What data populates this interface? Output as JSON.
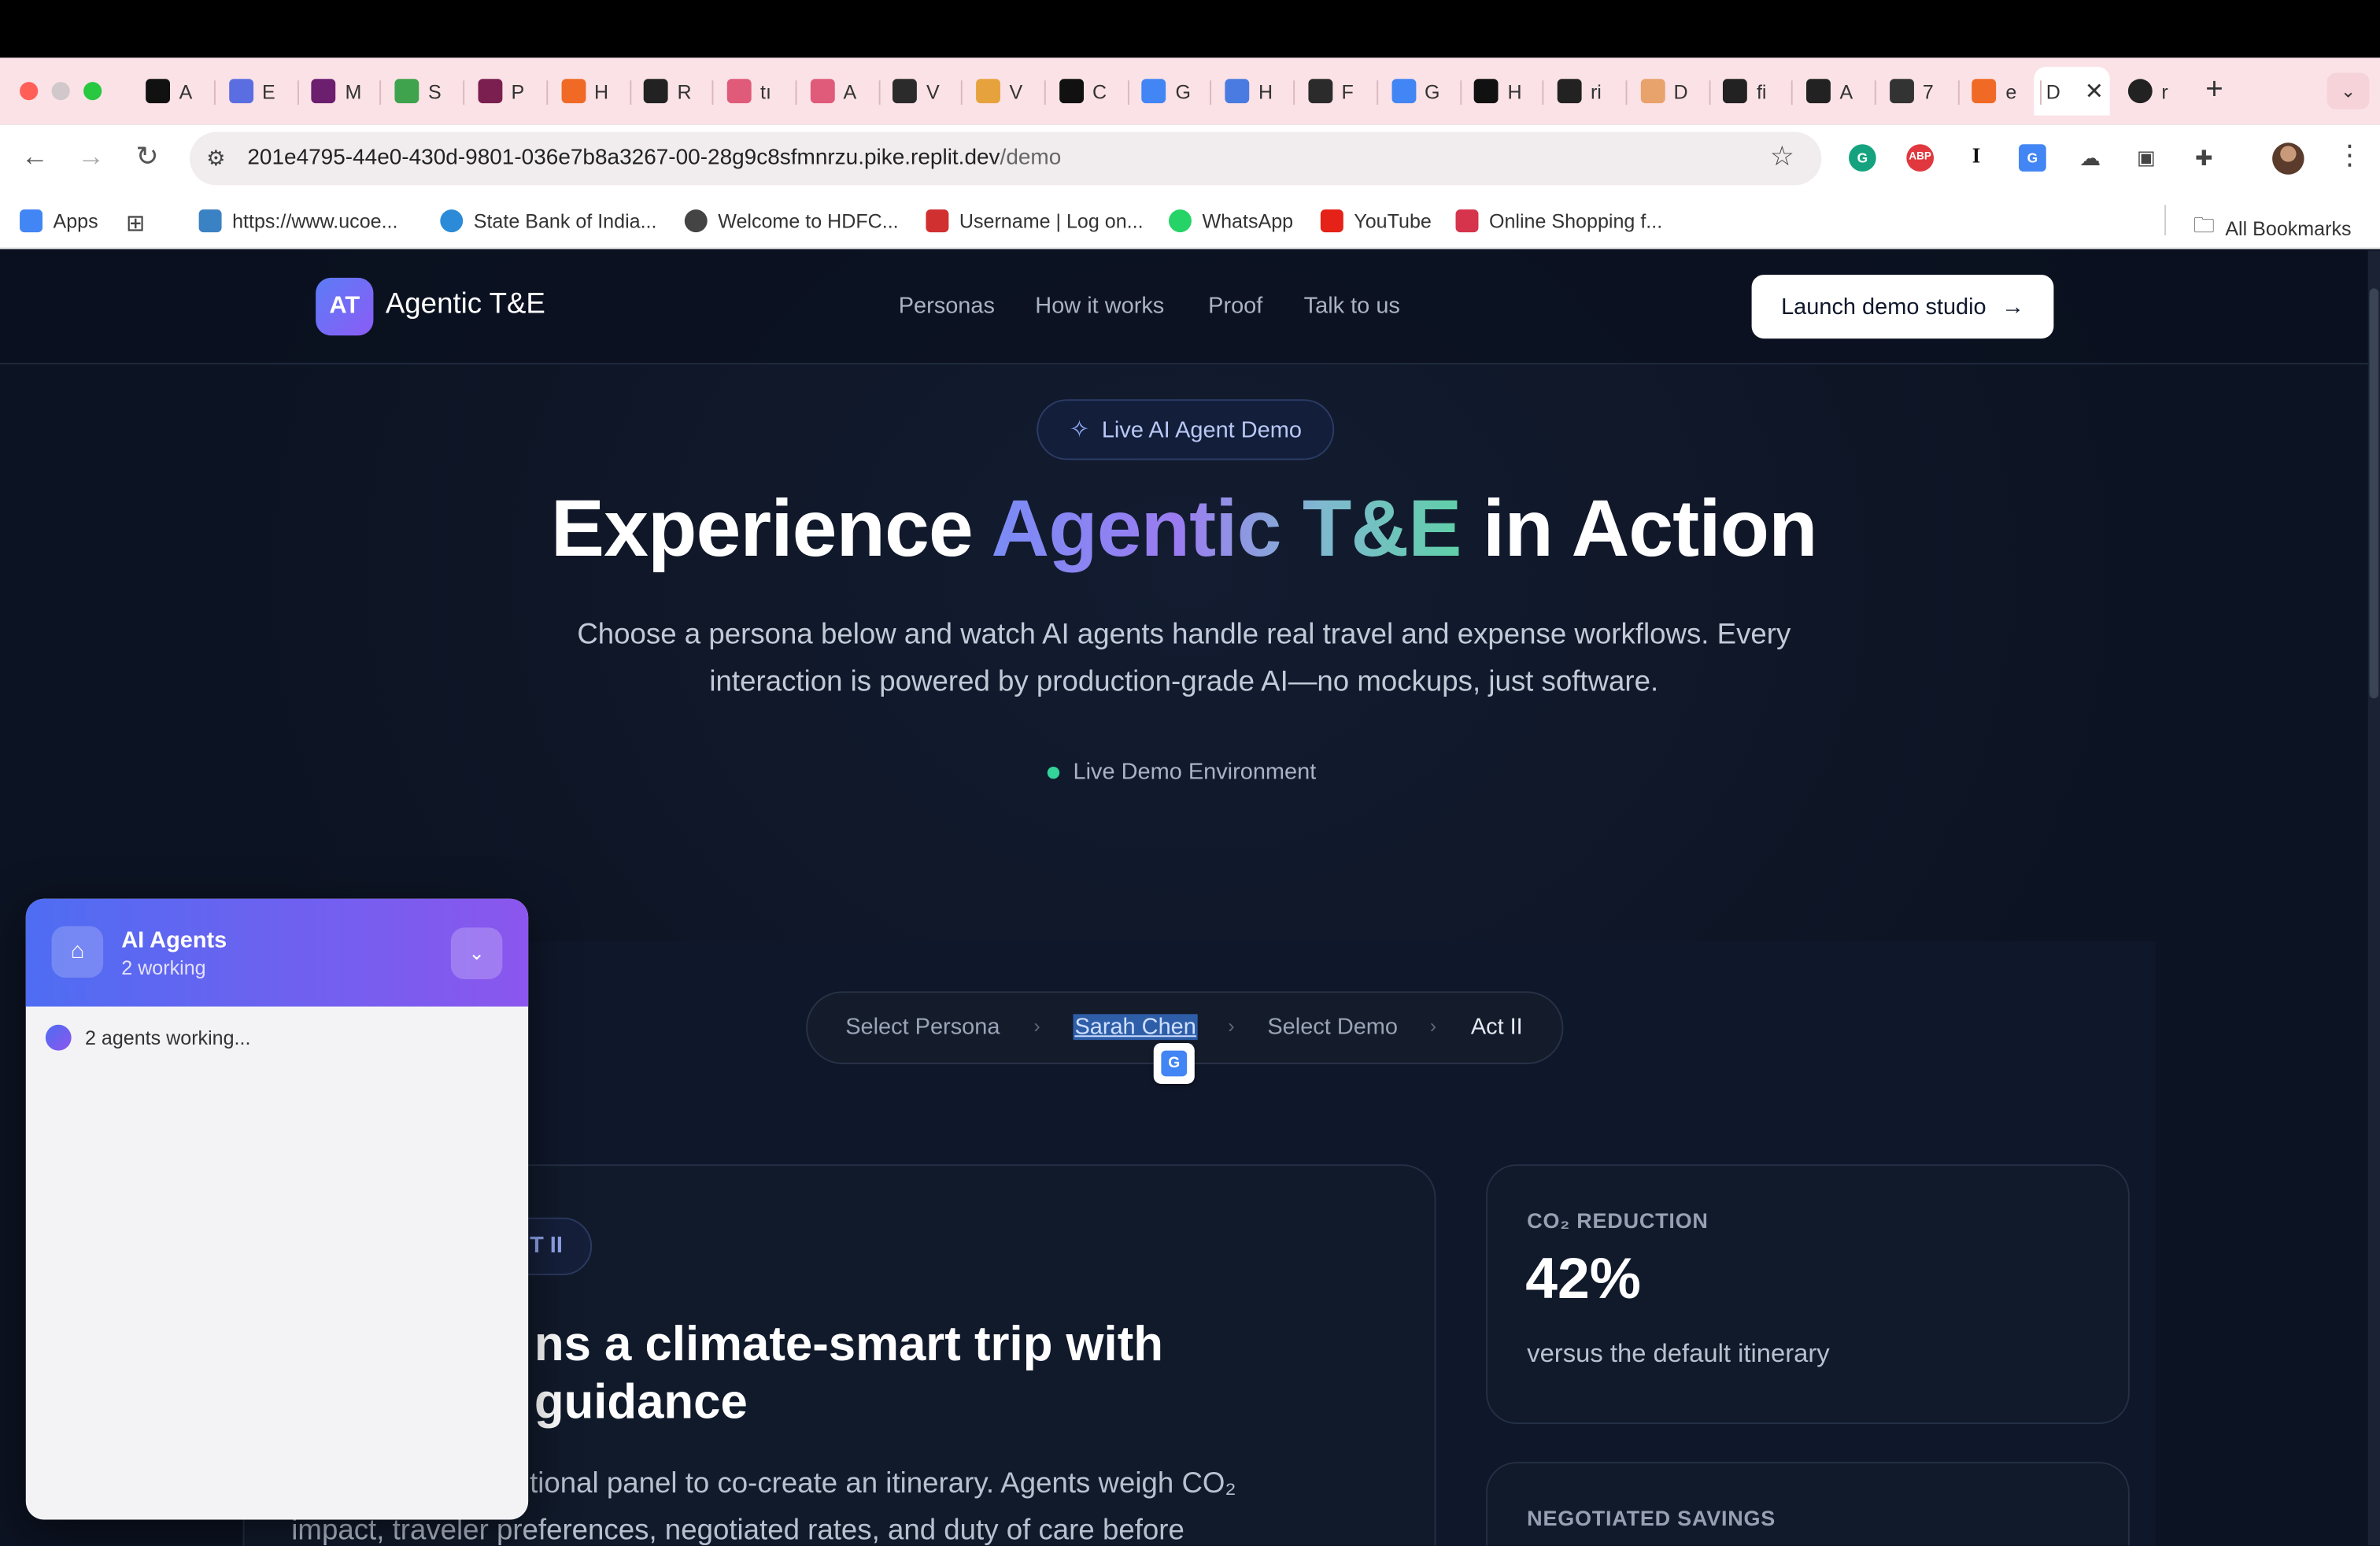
{
  "browser": {
    "tabs": [
      {
        "label": "A",
        "color": "#111111"
      },
      {
        "label": "E",
        "color": "#5b6ee1"
      },
      {
        "label": "M",
        "color": "#6b1f6e"
      },
      {
        "label": "S",
        "color": "#3fa34d"
      },
      {
        "label": "P",
        "color": "#7a1f4f"
      },
      {
        "label": "H",
        "color": "#f06a25"
      },
      {
        "label": "R",
        "color": "#222222"
      },
      {
        "label": "tı",
        "color": "#e05a7a"
      },
      {
        "label": "A",
        "color": "#e05a7a"
      },
      {
        "label": "V",
        "color": "#2b2b2b"
      },
      {
        "label": "V",
        "color": "#e6a23c"
      },
      {
        "label": "C",
        "color": "#111111"
      },
      {
        "label": "G",
        "color": "#4285f4"
      },
      {
        "label": "H",
        "color": "#4a7be0"
      },
      {
        "label": "F",
        "color": "#2b2b2b"
      },
      {
        "label": "G",
        "color": "#4285f4"
      },
      {
        "label": "H",
        "color": "#111111"
      },
      {
        "label": "ri",
        "color": "#222222"
      },
      {
        "label": "D",
        "color": "#e8a26b"
      },
      {
        "label": "fi",
        "color": "#222222"
      },
      {
        "label": "A",
        "color": "#222222"
      },
      {
        "label": "7",
        "color": "#333333"
      },
      {
        "label": "e",
        "color": "#f06a25"
      }
    ],
    "active_tab": {
      "label": "D",
      "close": "✕"
    },
    "last_tab": {
      "label": "r"
    },
    "new_tab": "+",
    "url_host": "201e4795-44e0-430d-9801-036e7b8a3267-00-28g9c8sfmnrzu.pike.replit.dev",
    "url_path": "/demo",
    "bookmarks": [
      {
        "label": "Apps",
        "color": "#4285f4"
      },
      {
        "label": "https://www.ucoe...",
        "color": "#3b82c4"
      },
      {
        "label": "State Bank of India...",
        "color": "#2b8bd8"
      },
      {
        "label": "Welcome to HDFC...",
        "color": "#444444"
      },
      {
        "label": "Username | Log on...",
        "color": "#d0302f"
      },
      {
        "label": "WhatsApp",
        "color": "#25d366"
      },
      {
        "label": "YouTube",
        "color": "#e62117"
      },
      {
        "label": "Online Shopping f...",
        "color": "#d6334c"
      }
    ],
    "all_bookmarks": "All Bookmarks"
  },
  "site": {
    "logo_badge": "AT",
    "logo_text": "Agentic T&E",
    "nav": [
      "Personas",
      "How it works",
      "Proof",
      "Talk to us"
    ],
    "cta": "Launch demo studio",
    "cta_arrow": "→"
  },
  "hero": {
    "pill": "Live AI Agent Demo",
    "title_pre": "Experience ",
    "title_grad": "Agentic T&E",
    "title_post": " in Action",
    "subtitle": "Choose a persona below and watch AI agents handle real travel and expense workflows. Every interaction is powered by production-grade AI—no mockups, just software.",
    "live_env": "Live Demo Environment"
  },
  "breadcrumb": {
    "items": [
      "Select Persona",
      "Sarah Chen",
      "Select Demo",
      "Act II"
    ],
    "separator": "›"
  },
  "main_card": {
    "act_label": "T II",
    "title": "ns a climate-smart trip with guidance",
    "title_line1": "ns a climate-smart trip with",
    "title_line2": "guidance",
    "body_line1": "tional panel to co-create an itinerary. Agents weigh CO₂",
    "body_line2": "impact, traveler preferences, negotiated rates, and duty of care before"
  },
  "stats": [
    {
      "label": "CO₂ REDUCTION",
      "value": "42%",
      "desc": "versus the default itinerary"
    },
    {
      "label": "NEGOTIATED SAVINGS"
    }
  ],
  "agents_panel": {
    "title": "AI Agents",
    "subtitle": "2 working",
    "status": "2 agents working..."
  }
}
